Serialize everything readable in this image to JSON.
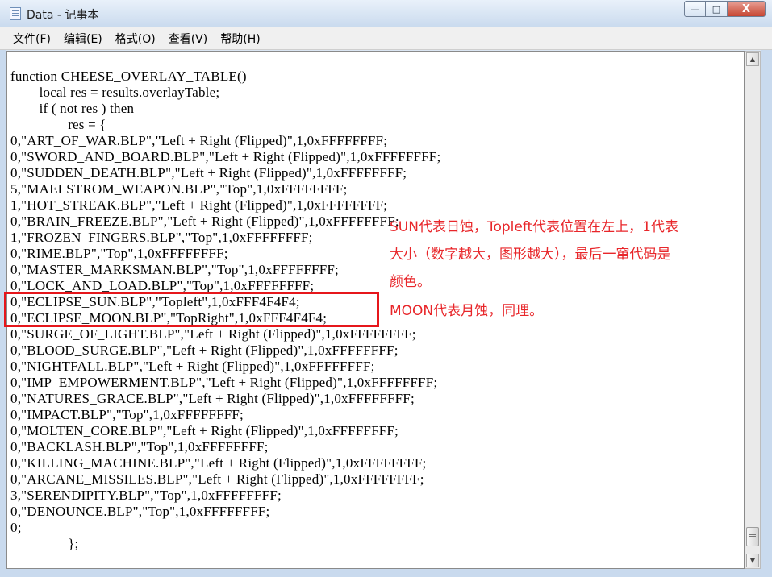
{
  "window": {
    "title": "Data - 记事本"
  },
  "menu": [
    "文件(F)",
    "编辑(E)",
    "格式(O)",
    "查看(V)",
    "帮助(H)"
  ],
  "controls": {
    "minimize": "—",
    "maximize": "□",
    "close": "X"
  },
  "code": [
    "function CHEESE_OVERLAY_TABLE()",
    "        local res = results.overlayTable;",
    "        if ( not res ) then",
    "                res = {",
    "0,\"ART_OF_WAR.BLP\",\"Left + Right (Flipped)\",1,0xFFFFFFFF;",
    "0,\"SWORD_AND_BOARD.BLP\",\"Left + Right (Flipped)\",1,0xFFFFFFFF;",
    "0,\"SUDDEN_DEATH.BLP\",\"Left + Right (Flipped)\",1,0xFFFFFFFF;",
    "5,\"MAELSTROM_WEAPON.BLP\",\"Top\",1,0xFFFFFFFF;",
    "1,\"HOT_STREAK.BLP\",\"Left + Right (Flipped)\",1,0xFFFFFFFF;",
    "0,\"BRAIN_FREEZE.BLP\",\"Left + Right (Flipped)\",1,0xFFFFFFFF;",
    "1,\"FROZEN_FINGERS.BLP\",\"Top\",1,0xFFFFFFFF;",
    "0,\"RIME.BLP\",\"Top\",1,0xFFFFFFFF;",
    "0,\"MASTER_MARKSMAN.BLP\",\"Top\",1,0xFFFFFFFF;",
    "0,\"LOCK_AND_LOAD.BLP\",\"Top\",1,0xFFFFFFFF;",
    "0,\"ECLIPSE_SUN.BLP\",\"Topleft\",1,0xFFF4F4F4;",
    "0,\"ECLIPSE_MOON.BLP\",\"TopRight\",1,0xFFF4F4F4;",
    "0,\"SURGE_OF_LIGHT.BLP\",\"Left + Right (Flipped)\",1,0xFFFFFFFF;",
    "0,\"BLOOD_SURGE.BLP\",\"Left + Right (Flipped)\",1,0xFFFFFFFF;",
    "0,\"NIGHTFALL.BLP\",\"Left + Right (Flipped)\",1,0xFFFFFFFF;",
    "0,\"IMP_EMPOWERMENT.BLP\",\"Left + Right (Flipped)\",1,0xFFFFFFFF;",
    "0,\"NATURES_GRACE.BLP\",\"Left + Right (Flipped)\",1,0xFFFFFFFF;",
    "0,\"IMPACT.BLP\",\"Top\",1,0xFFFFFFFF;",
    "0,\"MOLTEN_CORE.BLP\",\"Left + Right (Flipped)\",1,0xFFFFFFFF;",
    "0,\"BACKLASH.BLP\",\"Top\",1,0xFFFFFFFF;",
    "0,\"KILLING_MACHINE.BLP\",\"Left + Right (Flipped)\",1,0xFFFFFFFF;",
    "0,\"ARCANE_MISSILES.BLP\",\"Left + Right (Flipped)\",1,0xFFFFFFFF;",
    "3,\"SERENDIPITY.BLP\",\"Top\",1,0xFFFFFFFF;",
    "0,\"DENOUNCE.BLP\",\"Top\",1,0xFFFFFFFF;",
    "0;",
    "                };"
  ],
  "annotation": {
    "line1": "SUN代表日蚀，Topleft代表位置在左上，1代表",
    "line2": "大小（数字越大，图形越大），最后一窜代码是",
    "line3": "颜色。",
    "line4": "MOON代表月蚀，同理。",
    "color": "#e8262a"
  }
}
